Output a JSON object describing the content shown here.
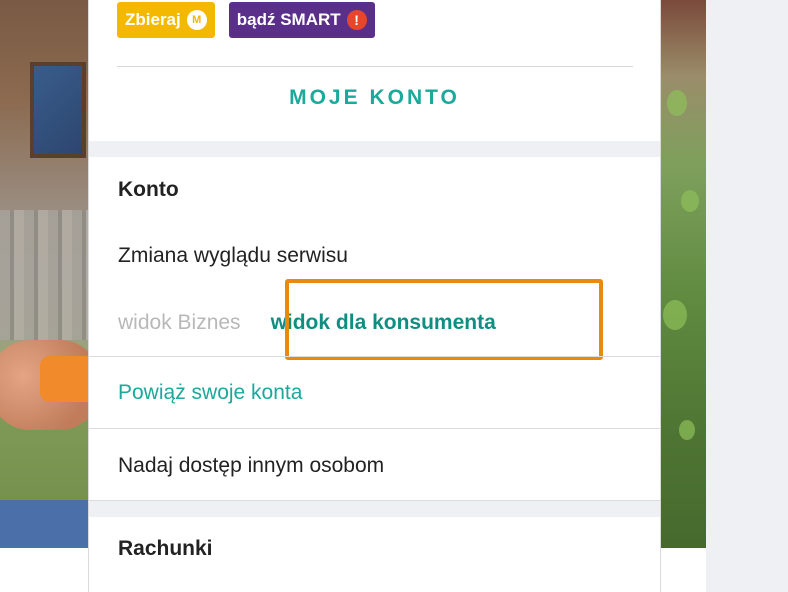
{
  "badges": {
    "zbieraj": {
      "label": "Zbieraj",
      "icon": "m-coin-icon",
      "icon_glyph": "M",
      "color": "#f5b800"
    },
    "smart": {
      "label": "bądź SMART",
      "icon": "exclamation-shield-icon",
      "icon_glyph": "!",
      "color": "#5a2f8a"
    }
  },
  "menu": {
    "title": "MOJE KONTO",
    "sections": {
      "konto": {
        "heading": "Konto",
        "appearance_label": "Zmiana wyglądu serwisu",
        "view_options": {
          "business": "widok Biznes",
          "consumer": "widok dla konsumenta",
          "selected": "widok dla konsumenta"
        },
        "link_accounts": "Powiąż swoje konta",
        "grant_access": "Nadaj dostęp innym osobom"
      },
      "rachunki": {
        "heading": "Rachunki"
      }
    }
  },
  "colors": {
    "accent": "#1aa99a",
    "accent_dark": "#0f8f82",
    "highlight": "#e88a0b",
    "muted": "#b8b8b8",
    "band": "#eef0f3"
  }
}
